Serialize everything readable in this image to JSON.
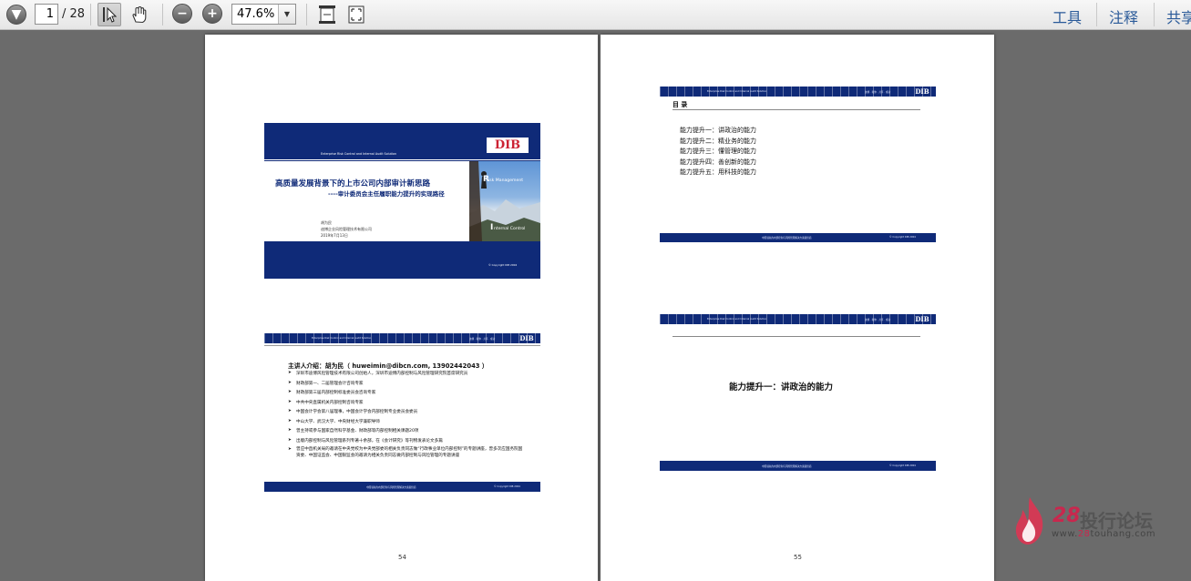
{
  "toolbar": {
    "page_current": "1",
    "page_total": "/ 28",
    "zoom": "47.6%",
    "right_links": [
      "工具",
      "注释",
      "共享"
    ]
  },
  "cover": {
    "subtitle_en": "Enterprise Risk Control and Internal Audit Solution",
    "title": "高质量发展背景下的上市公司内部审计新思路",
    "subtitle": "----审计委员会主任履职能力提升的实现路径",
    "author": "胡为民",
    "company": "迪博企业风险管理技术有限公司",
    "date": "2019年7月13日",
    "logo": "DIB",
    "risk_text": "isk Management",
    "risk_initial": "R",
    "internal_text": "nternal Control",
    "internal_initial": "I",
    "copyright": "© Copyright DIB 2004"
  },
  "header_tagline": "Enterprise Risk Control and Internal Audit Solution",
  "header_right": "迪博 · 和你 · 共享 · 成功",
  "footer_center": "中国领先的内部控制与风险管理解决方案提供商",
  "footer_right": "© Copyright DIB 2004",
  "intro": {
    "heading": "主讲人介绍：胡为民（ huweimin@dibcn.com, 13902442043 ）",
    "bullets": [
      "深圳市迪博风险管理技术有限公司创始人，深圳市迪博内部控制与风险管理研究院首席研究员",
      "财政部第一、二届管理会计咨询专家",
      "财政部第三届内部控制标准委员会咨询专家",
      "中共中央直属机关内部控制咨询专家",
      "中国会计学会第八届理事，中国会计学会内部控制专业委员会委员",
      "中山大学、武汉大学、中央财经大学兼职导师",
      "曾主持或参与国家自然科学基金、财政部等内部控制相关课题20项",
      "出版内部控制与风险管理系列专著十余部，在《会计研究》等刊物发表论文多篇",
      "曾应中直机关局的邀请在中央党校为中央党部委的相关负责同志做“行政事业单位内部控制”的专题讲座，曾多次应国务院国资委、中国证监会、中国银监会的邀请为相关负责同志做内部控制与风险管理的专题讲座"
    ]
  },
  "toc": {
    "heading": "目 录",
    "items": [
      "能力提升一：讲政治的能力",
      "能力提升二：精业务的能力",
      "能力提升三：懂管理的能力",
      "能力提升四：善创新的能力",
      "能力提升五：用科技的能力"
    ]
  },
  "section": {
    "title": "能力提升一：讲政治的能力"
  },
  "page_numbers": [
    "54",
    "55"
  ],
  "watermark": {
    "brand_num": "28",
    "brand_text": "投行论坛",
    "url_prefix": "www.",
    "url_highlight": "28",
    "url_suffix": "touhang.com"
  },
  "colors": {
    "navy": "#0f2a78",
    "background": "#6b6b6b",
    "link": "#2a5a99",
    "watermark": "#c8284e"
  }
}
